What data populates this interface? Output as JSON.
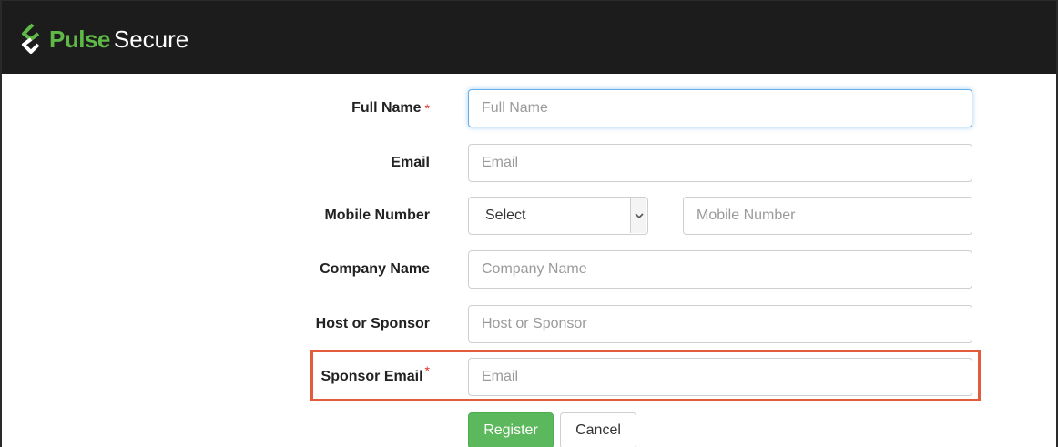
{
  "brand": {
    "name_part1": "Pulse",
    "name_part2": "Secure",
    "colors": {
      "pulse_green": "#5fb946",
      "header_bg": "#1c1c1c",
      "highlight": "#e45b3b",
      "register_green": "#5cb85c"
    }
  },
  "form": {
    "full_name": {
      "label": "Full Name",
      "required": "*",
      "placeholder": "Full Name"
    },
    "email": {
      "label": "Email",
      "placeholder": "Email"
    },
    "mobile": {
      "label": "Mobile Number",
      "select_value": "Select",
      "placeholder": "Mobile Number"
    },
    "company": {
      "label": "Company Name",
      "placeholder": "Company Name"
    },
    "host": {
      "label": "Host or Sponsor",
      "placeholder": "Host or Sponsor"
    },
    "sponsor_email": {
      "label": "Sponsor Email",
      "required": "*",
      "placeholder": "Email"
    }
  },
  "actions": {
    "register": "Register",
    "cancel": "Cancel"
  }
}
